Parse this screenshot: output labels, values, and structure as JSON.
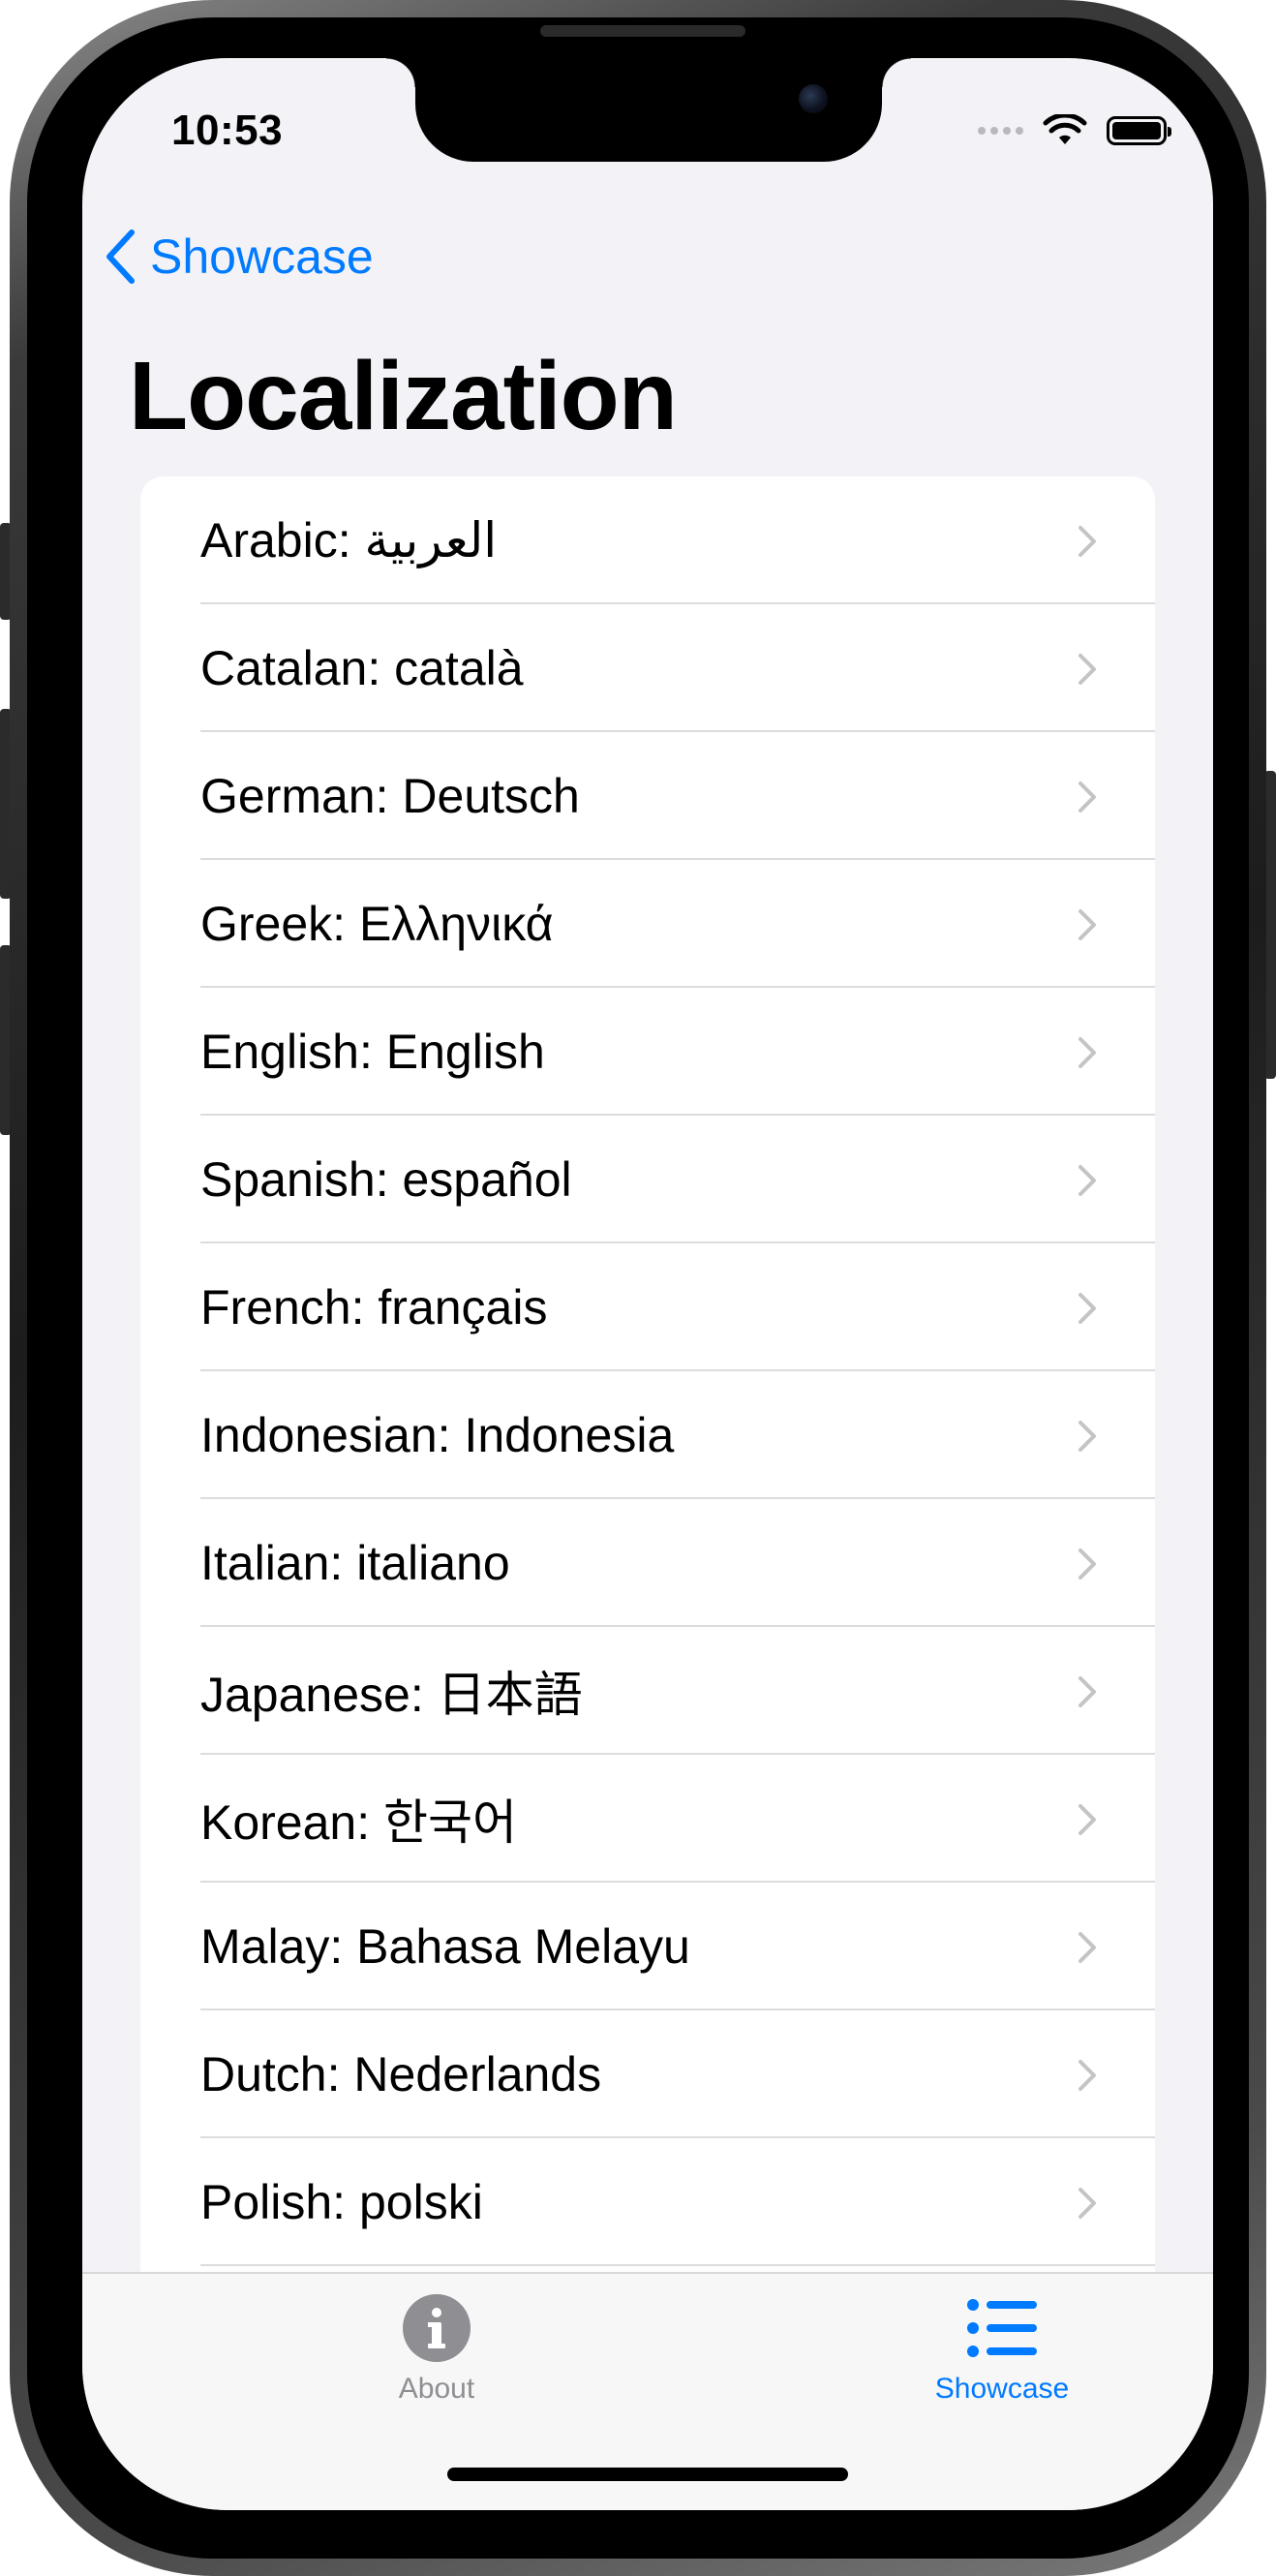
{
  "status_bar": {
    "time": "10:53"
  },
  "nav": {
    "back_label": "Showcase",
    "title": "Localization"
  },
  "languages": [
    "Arabic: العربية",
    "Catalan: català",
    "German: Deutsch",
    "Greek: Ελληνικά",
    "English: English",
    "Spanish: español",
    "French: français",
    "Indonesian: Indonesia",
    "Italian: italiano",
    "Japanese: 日本語",
    "Korean: 한국어",
    "Malay: Bahasa Melayu",
    "Dutch: Nederlands",
    "Polish: polski"
  ],
  "tabbar": {
    "tabs": [
      {
        "label": "About",
        "icon": "info-circle-icon",
        "selected": false
      },
      {
        "label": "Showcase",
        "icon": "list-bullet-icon",
        "selected": true
      }
    ]
  },
  "colors": {
    "accent": "#007aff",
    "background": "#f2f2f7",
    "inactive_tab": "#8e8e93"
  }
}
